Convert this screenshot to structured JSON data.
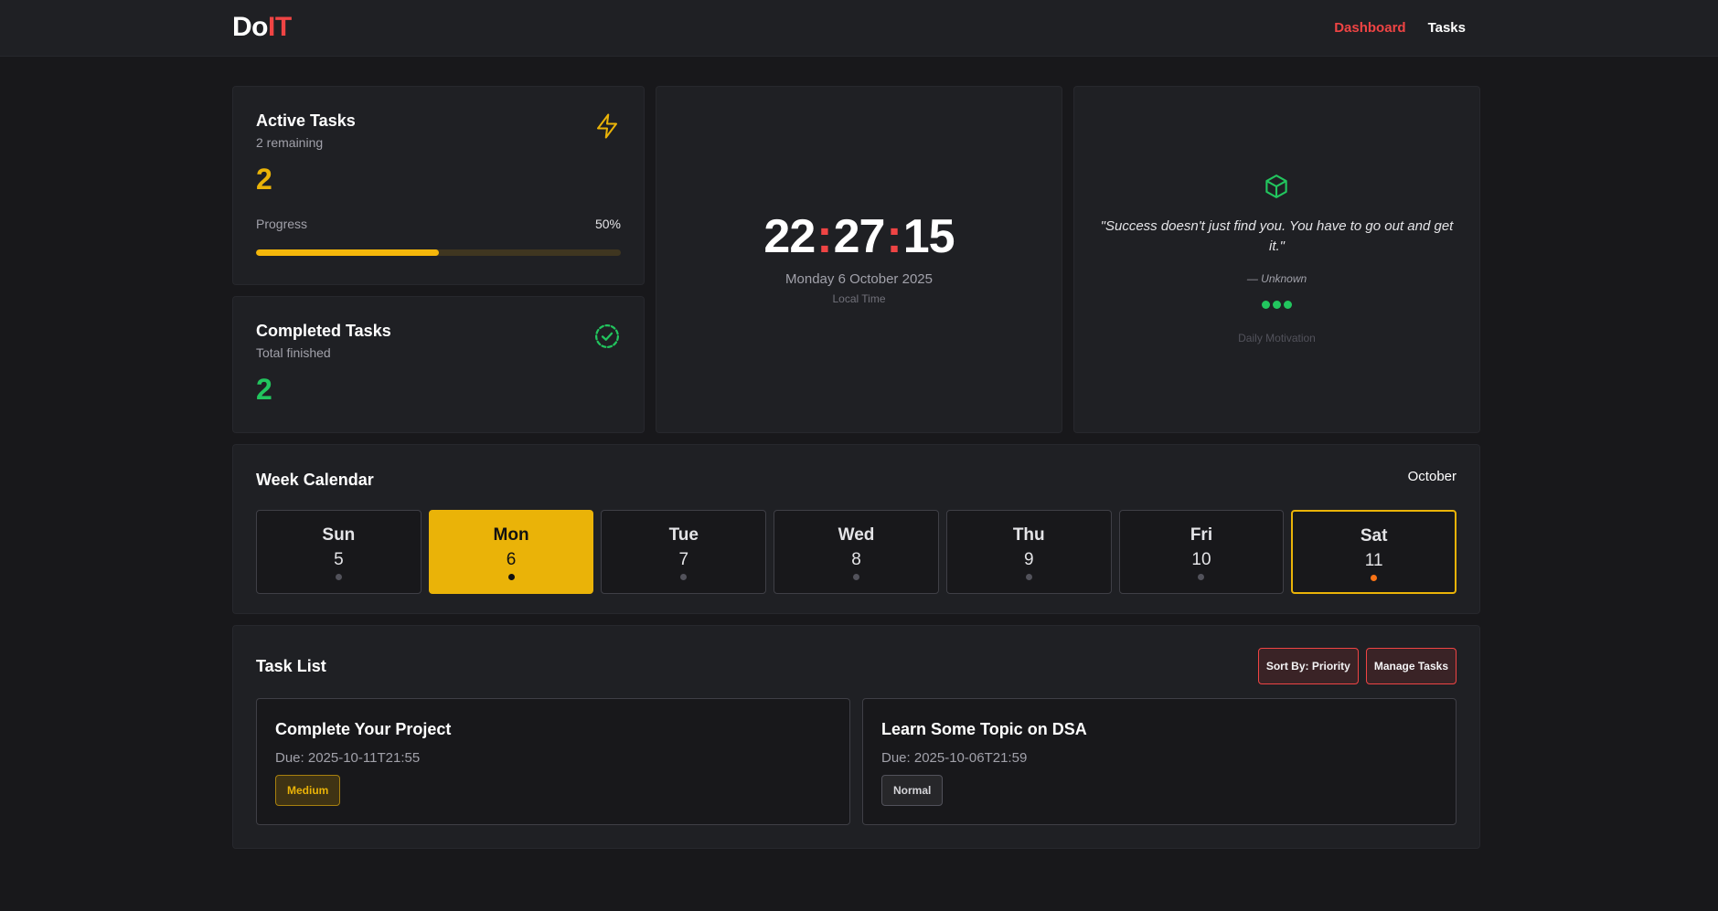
{
  "app": {
    "logo_part1": "Do",
    "logo_part2": "IT"
  },
  "nav": {
    "dashboard": "Dashboard",
    "tasks": "Tasks"
  },
  "active_tasks": {
    "title": "Active Tasks",
    "subtitle": "2 remaining",
    "count": "2",
    "progress_label": "Progress",
    "progress_text": "50%",
    "progress_fraction": 0.5,
    "icon": "lightning-icon"
  },
  "completed_tasks": {
    "title": "Completed Tasks",
    "subtitle": "Total finished",
    "count": "2",
    "icon": "check-circle-icon"
  },
  "clock": {
    "hours": "22",
    "minutes": "27",
    "seconds": "15",
    "separator": ":",
    "date": "Monday 6 October 2025",
    "label": "Local Time"
  },
  "quote": {
    "icon": "cube-icon",
    "text": "\"Success doesn't just find you. You have to go out and get it.\"",
    "author": "— Unknown",
    "label": "Daily Motivation"
  },
  "calendar": {
    "title": "Week Calendar",
    "month": "October",
    "days": [
      {
        "name": "Sun",
        "num": "5"
      },
      {
        "name": "Mon",
        "num": "6"
      },
      {
        "name": "Tue",
        "num": "7"
      },
      {
        "name": "Wed",
        "num": "8"
      },
      {
        "name": "Thu",
        "num": "9"
      },
      {
        "name": "Fri",
        "num": "10"
      },
      {
        "name": "Sat",
        "num": "11"
      }
    ]
  },
  "task_list": {
    "title": "Task List",
    "sort_label": "Sort By: Priority",
    "manage_label": "Manage Tasks",
    "tasks": [
      {
        "title": "Complete Your Project",
        "due": "Due: 2025-10-11T21:55",
        "priority": "Medium"
      },
      {
        "title": "Learn Some Topic on DSA",
        "due": "Due: 2025-10-06T21:59",
        "priority": "Normal"
      }
    ]
  },
  "colors": {
    "accent_red": "#ef4444",
    "accent_yellow": "#eab308",
    "accent_green": "#22c55e",
    "background": "#18181b",
    "card": "#1f2024"
  }
}
